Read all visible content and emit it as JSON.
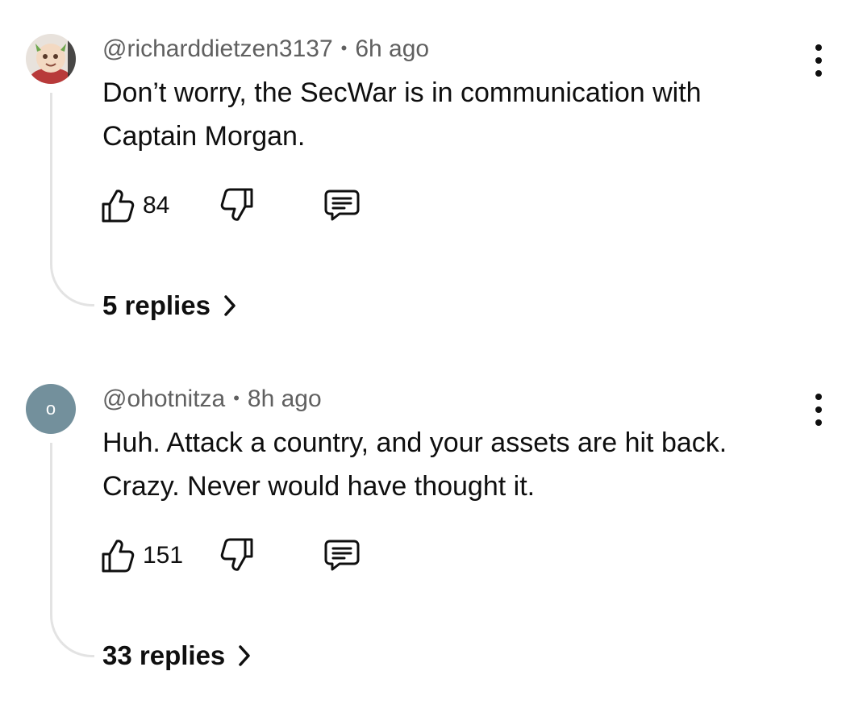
{
  "comments": [
    {
      "author": "@richarddietzen3137",
      "time": "6h ago",
      "text_line1": "Don’t worry, the SecWar is in communication with",
      "text_line2": "Captain Morgan.",
      "likes": "84",
      "replies_label": "5 replies",
      "avatar_letter": ""
    },
    {
      "author": "@ohotnitza",
      "time": "8h ago",
      "text_line1": "Huh. Attack a country, and your assets are hit back.",
      "text_line2": "Crazy. Never would have thought it.",
      "likes": "151",
      "replies_label": "33 replies",
      "avatar_letter": "o"
    }
  ],
  "separator": "•",
  "icons": {
    "like": "thumbs-up-icon",
    "dislike": "thumbs-down-icon",
    "reply": "comment-icon",
    "more": "more-vertical-icon",
    "expand": "chevron-right-icon"
  },
  "colors": {
    "avatar_bg": "#73909c",
    "meta_text": "#606060",
    "thread_line": "#e3e3e3"
  }
}
